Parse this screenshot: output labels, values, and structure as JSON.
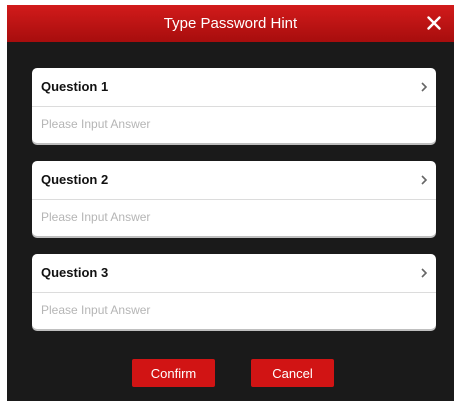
{
  "dialog": {
    "title": "Type Password Hint",
    "close_icon": "close-icon"
  },
  "questions": [
    {
      "label": "Question 1",
      "answer_placeholder": "Please Input Answer",
      "answer_value": ""
    },
    {
      "label": "Question 2",
      "answer_placeholder": "Please Input Answer",
      "answer_value": ""
    },
    {
      "label": "Question 3",
      "answer_placeholder": "Please Input Answer",
      "answer_value": ""
    }
  ],
  "buttons": {
    "confirm_label": "Confirm",
    "cancel_label": "Cancel"
  },
  "colors": {
    "title_bar": "#c81616",
    "dialog_background": "#1a1a1a",
    "button": "#d11414"
  }
}
